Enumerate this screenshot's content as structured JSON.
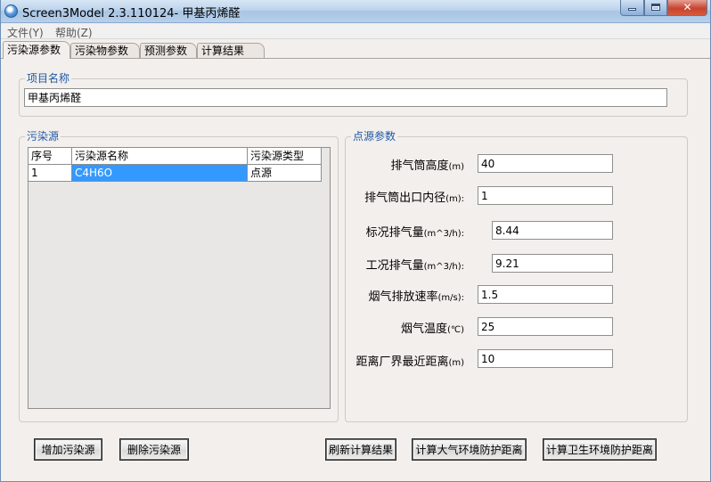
{
  "window": {
    "title": "Screen3Model 2.3.110124- 甲基丙烯醛"
  },
  "menu": {
    "file": "文件(Y)",
    "help": "帮助(Z)"
  },
  "tabs": [
    {
      "label": "污染源参数",
      "active": true
    },
    {
      "label": "污染物参数",
      "active": false
    },
    {
      "label": "预测参数",
      "active": false
    },
    {
      "label": "计算结果",
      "active": false
    }
  ],
  "project": {
    "group_label": "项目名称",
    "name_value": "甲基丙烯醛"
  },
  "sources": {
    "group_label": "污染源",
    "columns": [
      "序号",
      "污染源名称",
      "污染源类型"
    ],
    "rows": [
      {
        "index": "1",
        "name": "C4H6O",
        "type": "点源"
      }
    ]
  },
  "point_source": {
    "group_label": "点源参数",
    "params": [
      {
        "label": "排气筒高度",
        "unit": "(m)",
        "value": "40"
      },
      {
        "label": "排气筒出口内径",
        "unit": "(m):",
        "value": "1"
      },
      {
        "label": "标况排气量",
        "unit": "(m^3/h):",
        "value": "8.44"
      },
      {
        "label": "工况排气量",
        "unit": "(m^3/h):",
        "value": "9.21"
      },
      {
        "label": "烟气排放速率",
        "unit": "(m/s):",
        "value": "1.5"
      },
      {
        "label": "烟气温度",
        "unit": "(℃)",
        "value": "25"
      },
      {
        "label": "距离厂界最近距离",
        "unit": "(m)",
        "value": "10"
      }
    ]
  },
  "buttons": {
    "add_source": "增加污染源",
    "delete_source": "删除污染源",
    "refresh": "刷新计算结果",
    "calc_air": "计算大气环境防护距离",
    "calc_health": "计算卫生环境防护距离"
  }
}
